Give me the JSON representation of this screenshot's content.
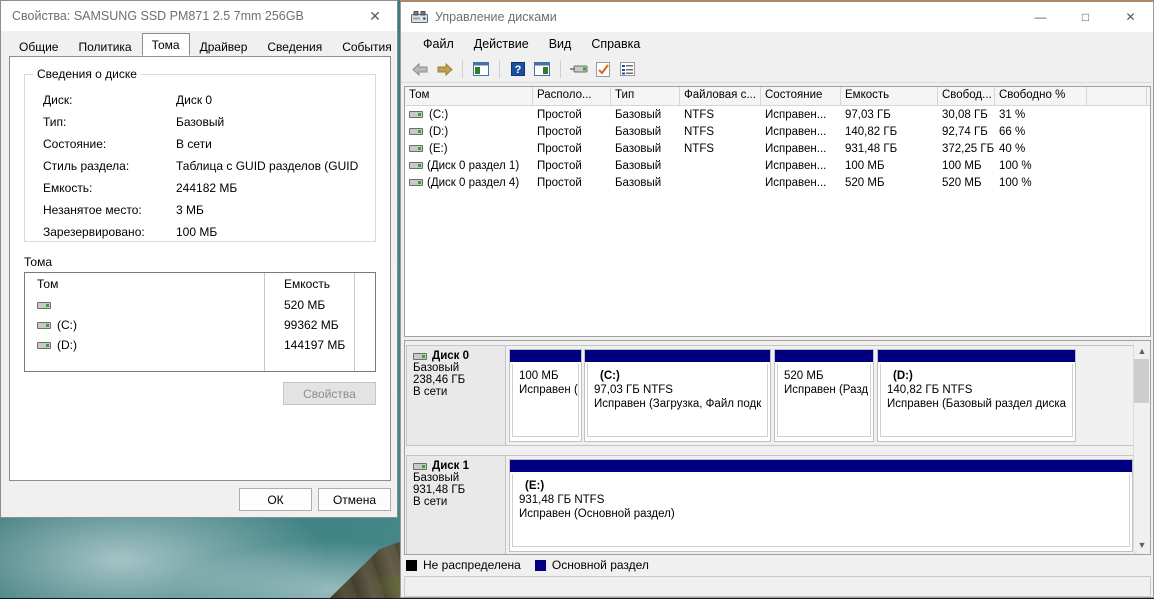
{
  "properties_dialog": {
    "title": "Свойства: SAMSUNG SSD PM871 2.5 7mm 256GB",
    "close_icon": "✕",
    "tabs": [
      {
        "label": "Общие",
        "active": false
      },
      {
        "label": "Политика",
        "active": false
      },
      {
        "label": "Тома",
        "active": true
      },
      {
        "label": "Драйвер",
        "active": false
      },
      {
        "label": "Сведения",
        "active": false
      },
      {
        "label": "События",
        "active": false
      }
    ],
    "disk_info_group": {
      "legend": "Сведения о диске",
      "rows": [
        {
          "key": "Диск:",
          "value": "Диск 0"
        },
        {
          "key": "Тип:",
          "value": "Базовый"
        },
        {
          "key": "Состояние:",
          "value": "В сети"
        },
        {
          "key": "Стиль раздела:",
          "value": "Таблица с GUID разделов (GUID"
        },
        {
          "key": "Емкость:",
          "value": "244182 МБ"
        },
        {
          "key": "Незанятое место:",
          "value": "3 МБ"
        },
        {
          "key": "Зарезервировано:",
          "value": "100 МБ"
        }
      ]
    },
    "volumes_group": {
      "legend": "Тома",
      "columns": [
        "Том",
        "Емкость"
      ],
      "rows": [
        {
          "name": "",
          "capacity": "520 МБ"
        },
        {
          "name": "(C:)",
          "capacity": "99362 МБ"
        },
        {
          "name": "(D:)",
          "capacity": "144197 МБ"
        }
      ]
    },
    "properties_button": "Свойства",
    "ok_button": "ОК",
    "cancel_button": "Отмена"
  },
  "disk_management": {
    "title": "Управление дисками",
    "window_controls": {
      "minimize": "—",
      "maximize": "□",
      "close": "✕"
    },
    "menu": [
      "Файл",
      "Действие",
      "Вид",
      "Справка"
    ],
    "toolbar_icons": [
      "back-arrow-icon",
      "forward-arrow-icon",
      "up-folder-icon",
      "help-icon",
      "show-hide-pane-icon",
      "rescan-disks-icon",
      "properties-icon",
      "list-icon"
    ],
    "volume_list": {
      "columns": [
        "Том",
        "Располо...",
        "Тип",
        "Файловая с...",
        "Состояние",
        "Емкость",
        "Свобод...",
        "Свободно %"
      ],
      "rows": [
        {
          "volume": "(C:)",
          "layout": "Простой",
          "type": "Базовый",
          "fs": "NTFS",
          "status": "Исправен...",
          "capacity": "97,03 ГБ",
          "free": "30,08 ГБ",
          "free_pct": "31 %"
        },
        {
          "volume": "(D:)",
          "layout": "Простой",
          "type": "Базовый",
          "fs": "NTFS",
          "status": "Исправен...",
          "capacity": "140,82 ГБ",
          "free": "92,74 ГБ",
          "free_pct": "66 %"
        },
        {
          "volume": "(E:)",
          "layout": "Простой",
          "type": "Базовый",
          "fs": "NTFS",
          "status": "Исправен...",
          "capacity": "931,48 ГБ",
          "free": "372,25 ГБ",
          "free_pct": "40 %"
        },
        {
          "volume": "(Диск 0 раздел 1)",
          "layout": "Простой",
          "type": "Базовый",
          "fs": "",
          "status": "Исправен...",
          "capacity": "100 МБ",
          "free": "100 МБ",
          "free_pct": "100 %"
        },
        {
          "volume": "(Диск 0 раздел 4)",
          "layout": "Простой",
          "type": "Базовый",
          "fs": "",
          "status": "Исправен...",
          "capacity": "520 МБ",
          "free": "520 МБ",
          "free_pct": "100 %"
        }
      ]
    },
    "graphical_view": {
      "disks": [
        {
          "name": "Диск 0",
          "type": "Базовый",
          "size": "238,46 ГБ",
          "state": "В сети",
          "partitions": [
            {
              "label": "",
              "size": "100 МБ",
              "status": "Исправен ("
            },
            {
              "label": "(C:)",
              "size": "97,03 ГБ NTFS",
              "status": "Исправен (Загрузка, Файл подк"
            },
            {
              "label": "",
              "size": "520 МБ",
              "status": "Исправен (Разд"
            },
            {
              "label": "(D:)",
              "size": "140,82 ГБ NTFS",
              "status": "Исправен (Базовый раздел диска"
            }
          ]
        },
        {
          "name": "Диск 1",
          "type": "Базовый",
          "size": "931,48 ГБ",
          "state": "В сети",
          "partitions": [
            {
              "label": "(E:)",
              "size": "931,48 ГБ NTFS",
              "status": "Исправен (Основной раздел)"
            }
          ]
        }
      ]
    },
    "legend": [
      {
        "label": "Не распределена",
        "color": "#000000"
      },
      {
        "label": "Основной раздел",
        "color": "#000080"
      }
    ]
  },
  "colors": {
    "primary_partition": "#000080",
    "unallocated": "#000000",
    "window_bg": "#f0f0f0",
    "list_bg": "#ffffff"
  }
}
